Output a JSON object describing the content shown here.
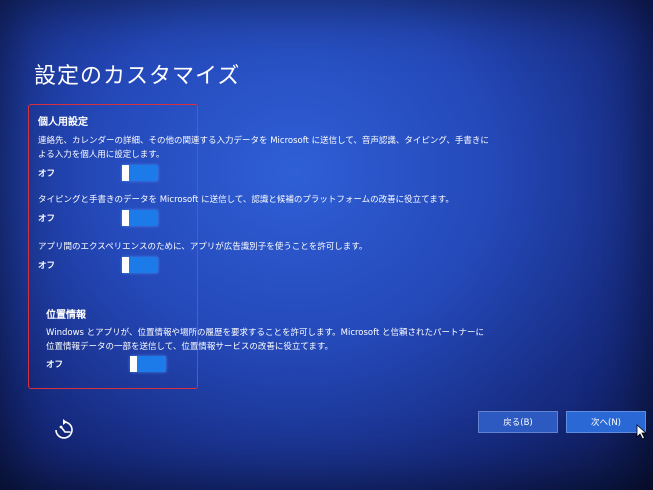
{
  "title": "設定のカスタマイズ",
  "sections": [
    {
      "heading": "個人用設定",
      "items": [
        {
          "lines": [
            "連絡先、カレンダーの詳細、その他の関連する入力データを Microsoft に送信して、音声認識、タイピング、手書きに",
            "よる入力を個人用に設定します。"
          ],
          "toggle_label": "オフ",
          "state": "off"
        },
        {
          "lines": [
            "タイピングと手書きのデータを Microsoft に送信して、認識と候補のプラットフォームの改善に役立てます。"
          ],
          "toggle_label": "オフ",
          "state": "off"
        },
        {
          "lines": [
            "アプリ間のエクスペリエンスのために、アプリが広告識別子を使うことを許可します。"
          ],
          "toggle_label": "オフ",
          "state": "off"
        }
      ]
    },
    {
      "heading": "位置情報",
      "items": [
        {
          "lines": [
            "Windows とアプリが、位置情報や場所の履歴を要求することを許可します。Microsoft と信頼されたパートナーに",
            "位置情報データの一部を送信して、位置情報サービスの改善に役立てます。"
          ],
          "toggle_label": "オフ",
          "state": "off"
        }
      ]
    }
  ],
  "buttons": {
    "back": "戻る(B)",
    "next": "次へ(N)"
  },
  "colors": {
    "background": "#2448b8",
    "toggle": "#1c7be8",
    "highlight_box": "#d8303c"
  },
  "icons": {
    "accessibility": "ease-of-access-icon",
    "cursor": "mouse-pointer-icon"
  }
}
